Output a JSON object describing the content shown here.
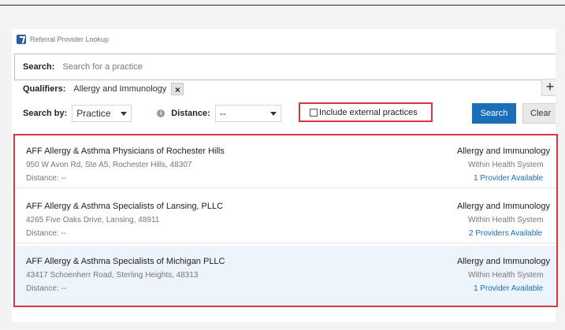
{
  "window": {
    "title": "Referral Provider Lookup"
  },
  "search": {
    "label": "Search:",
    "placeholder": "Search for a practice",
    "value": ""
  },
  "qualifiers": {
    "label": "Qualifiers:",
    "chip_label": "Allergy and Immunology",
    "chip_remove": "×",
    "add_label": "+"
  },
  "filters": {
    "search_by_label": "Search by:",
    "search_by_value": "Practice",
    "info_glyph": "i",
    "distance_label": "Distance:",
    "distance_value": "--",
    "external_label": "Include external practices",
    "external_checked": false,
    "search_button": "Search",
    "clear_button": "Clear"
  },
  "results": [
    {
      "name": "AFF Allergy & Asthma Physicians of Rochester Hills",
      "address": "950 W Avon Rd, Ste A5, Rochester Hills, 48307",
      "distance": "Distance: --",
      "specialty": "Allergy and Immunology",
      "system": "Within Health System",
      "availability": "1 Provider Available"
    },
    {
      "name": "AFF Allergy & Asthma Specialists of Lansing, PLLC",
      "address": "4265 Five Oaks Drive, Lansing, 48911",
      "distance": "Distance: --",
      "specialty": "Allergy and Immunology",
      "system": "Within Health System",
      "availability": "2 Providers Available"
    },
    {
      "name": "AFF Allergy & Asthma Specialists of Michigan PLLC",
      "address": "43417 Schoenherr Road, Sterling Heights, 48313",
      "distance": "Distance: --",
      "specialty": "Allergy and Immunology",
      "system": "Within Health System",
      "availability": "1 Provider Available"
    }
  ],
  "colors": {
    "accent": "#1a6fb8",
    "highlight_border": "#d9363e"
  }
}
